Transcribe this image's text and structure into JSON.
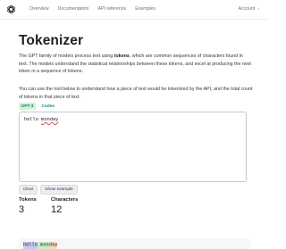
{
  "header": {
    "logo_icon": "openai-logo-icon",
    "nav": [
      "Overview",
      "Documentation",
      "API reference",
      "Examples"
    ],
    "account_label": "Account",
    "account_chevron": "›"
  },
  "page": {
    "title": "Tokenizer",
    "para1_a": "The GPT family of models process text using ",
    "para1_bold": "tokens",
    "para1_b": ", which are common sequences of characters found in text. The models understand the statistical relationships between these tokens, and excel at producing the next token in a sequence of tokens.",
    "para2": "You can use the tool below to understand how a piece of text would be tokenized by the API, and the total count of tokens in that piece of text."
  },
  "tabs": [
    {
      "label": "GPT-3",
      "active": true
    },
    {
      "label": "Codex",
      "active": false
    }
  ],
  "input": {
    "word1": "hello",
    "word2": "monday"
  },
  "buttons": {
    "clear": "Clear",
    "show_example": "Show example"
  },
  "stats": {
    "tokens_label": "Tokens",
    "tokens_value": "3",
    "characters_label": "Characters",
    "characters_value": "12"
  },
  "tokens": [
    {
      "text": "hello",
      "color": "#c9c7f0"
    },
    {
      "text": " mon",
      "color": "#c8ecc5"
    },
    {
      "text": "day",
      "color": "#f6dcc0"
    }
  ]
}
